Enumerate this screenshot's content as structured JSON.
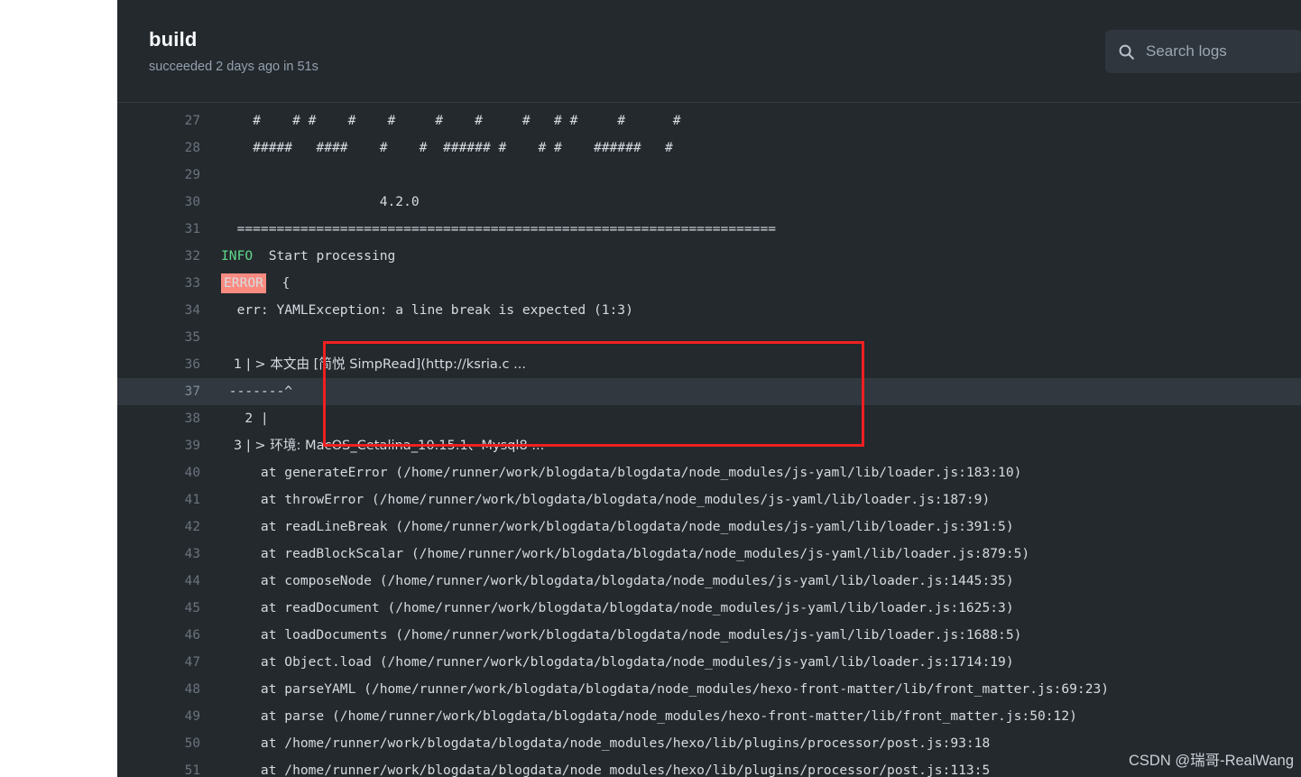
{
  "header": {
    "title": "build",
    "status_line": "succeeded 2 days ago in 51s"
  },
  "search": {
    "placeholder": "Search logs",
    "value": "",
    "icon": "search-icon"
  },
  "colors": {
    "panel_bg": "#24292e",
    "header_bg": "#24292e",
    "line_highlight": "#32383f",
    "info_green": "#5fd98a",
    "error_badge_bg": "#fb8b80",
    "annotation_red": "#ef2020",
    "line_number": "#6a737d",
    "log_text": "#d6dbe1"
  },
  "annotation": {
    "type": "red-rectangle",
    "covers_lines": [
      36,
      37,
      38
    ]
  },
  "watermark": {
    "text": "CSDN @瑞哥-RealWang"
  },
  "log": {
    "first_line_number": 27,
    "lines": [
      {
        "n": 27,
        "text": "    #    # #    #    #     #    #     #   # #     #      #",
        "highlight": false
      },
      {
        "n": 28,
        "text": "    #####   ####    #    #  ###### #    # #    ######   #",
        "highlight": false
      },
      {
        "n": 29,
        "text": "",
        "highlight": false
      },
      {
        "n": 30,
        "text": "                    4.2.0",
        "highlight": false
      },
      {
        "n": 31,
        "text": "  ====================================================================",
        "highlight": false
      },
      {
        "n": 32,
        "text": "Start processing",
        "prefix_token": "INFO",
        "prefix_type": "info",
        "highlight": false
      },
      {
        "n": 33,
        "text": "{",
        "prefix_token": "ERROR",
        "prefix_type": "error",
        "highlight": false
      },
      {
        "n": 34,
        "text": "  err: YAMLException: a line break is expected (1:3)",
        "highlight": false
      },
      {
        "n": 35,
        "text": "",
        "highlight": false
      },
      {
        "n": 36,
        "text": "   1 | > 本文由 [简悦 SimpRead](http://ksria.c ...",
        "highlight": false
      },
      {
        "n": 37,
        "text": " -------^",
        "highlight": true
      },
      {
        "n": 38,
        "text": "   2 |",
        "highlight": false
      },
      {
        "n": 39,
        "text": "   3 | > 环境: MacOS_Cetalina_10.15.1、Mysql8 ...",
        "highlight": false
      },
      {
        "n": 40,
        "text": "     at generateError (/home/runner/work/blogdata/blogdata/node_modules/js-yaml/lib/loader.js:183:10)",
        "highlight": false
      },
      {
        "n": 41,
        "text": "     at throwError (/home/runner/work/blogdata/blogdata/node_modules/js-yaml/lib/loader.js:187:9)",
        "highlight": false
      },
      {
        "n": 42,
        "text": "     at readLineBreak (/home/runner/work/blogdata/blogdata/node_modules/js-yaml/lib/loader.js:391:5)",
        "highlight": false
      },
      {
        "n": 43,
        "text": "     at readBlockScalar (/home/runner/work/blogdata/blogdata/node_modules/js-yaml/lib/loader.js:879:5)",
        "highlight": false
      },
      {
        "n": 44,
        "text": "     at composeNode (/home/runner/work/blogdata/blogdata/node_modules/js-yaml/lib/loader.js:1445:35)",
        "highlight": false
      },
      {
        "n": 45,
        "text": "     at readDocument (/home/runner/work/blogdata/blogdata/node_modules/js-yaml/lib/loader.js:1625:3)",
        "highlight": false
      },
      {
        "n": 46,
        "text": "     at loadDocuments (/home/runner/work/blogdata/blogdata/node_modules/js-yaml/lib/loader.js:1688:5)",
        "highlight": false
      },
      {
        "n": 47,
        "text": "     at Object.load (/home/runner/work/blogdata/blogdata/node_modules/js-yaml/lib/loader.js:1714:19)",
        "highlight": false
      },
      {
        "n": 48,
        "text": "     at parseYAML (/home/runner/work/blogdata/blogdata/node_modules/hexo-front-matter/lib/front_matter.js:69:23)",
        "highlight": false
      },
      {
        "n": 49,
        "text": "     at parse (/home/runner/work/blogdata/blogdata/node_modules/hexo-front-matter/lib/front_matter.js:50:12)",
        "highlight": false
      },
      {
        "n": 50,
        "text": "     at /home/runner/work/blogdata/blogdata/node_modules/hexo/lib/plugins/processor/post.js:93:18",
        "highlight": false
      },
      {
        "n": 51,
        "text": "     at /home/runner/work/blogdata/blogdata/node_modules/hexo/lib/plugins/processor/post.js:113:5",
        "highlight": false
      }
    ]
  }
}
